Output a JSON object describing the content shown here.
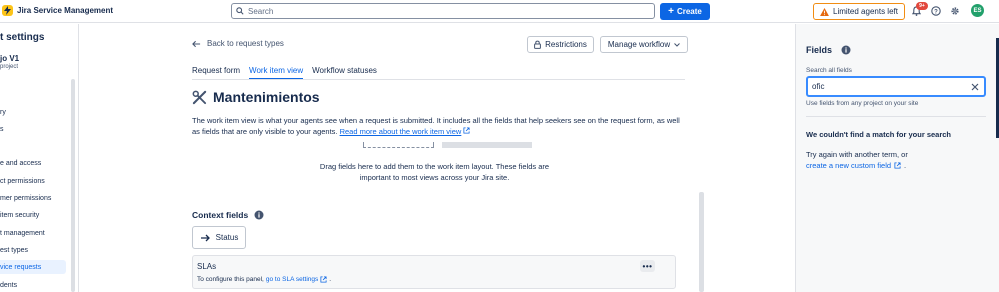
{
  "app": {
    "name": "Jira Service Management"
  },
  "search": {
    "placeholder": "Search"
  },
  "header": {
    "create_label": "Create",
    "limited_label": "Limited agents left",
    "notification_badge": "9+",
    "avatar_initials": "ES"
  },
  "sidebar": {
    "title": "t settings",
    "project_name": "jo V1",
    "project_sub": "project",
    "items": [
      {
        "label": "ry",
        "active": false
      },
      {
        "label": "s",
        "active": false
      },
      {
        "label": "e and access",
        "active": false
      },
      {
        "label": "ct permissions",
        "active": false
      },
      {
        "label": "mer permissions",
        "active": false
      },
      {
        "label": "item security",
        "active": false
      },
      {
        "label": "t management",
        "active": false
      },
      {
        "label": "est types",
        "active": false
      },
      {
        "label": "vice requests",
        "active": true
      },
      {
        "label": "dents",
        "active": false
      }
    ]
  },
  "main": {
    "back_label": "Back to request types",
    "restrictions_label": "Restrictions",
    "workflow_label": "Manage workflow",
    "tabs": [
      {
        "label": "Request form",
        "active": false
      },
      {
        "label": "Work item view",
        "active": true
      },
      {
        "label": "Workflow statuses",
        "active": false
      }
    ],
    "request_title": "Mantenimientos",
    "description_text": "The work item view is what your agents see when a request is submitted. It includes all the fields that help seekers see on the request form, as well as fields that are only visible to your agents.",
    "description_link": "Read more about the work item view",
    "drag_text_1": "Drag fields here to add them to the work item layout. These fields are",
    "drag_text_2": "important to most views across your Jira site.",
    "context_title": "Context fields",
    "status_label": "Status",
    "sla_title": "SLAs",
    "sla_text": "To configure this panel,",
    "sla_link": "go to SLA settings",
    "sla_period": "."
  },
  "panel": {
    "title": "Fields",
    "search_label": "Search all fields",
    "search_value": "ofic",
    "help_text": "Use fields from any project on your site",
    "no_match": "We couldn't find a match for your search",
    "try_text": "Try again with another term, or",
    "create_link": "create a new custom field",
    "create_period": "."
  },
  "colors": {
    "accent": "#0c66e4",
    "warning": "#f18d13",
    "badge": "#e2483d",
    "avatar": "#22a06b"
  }
}
